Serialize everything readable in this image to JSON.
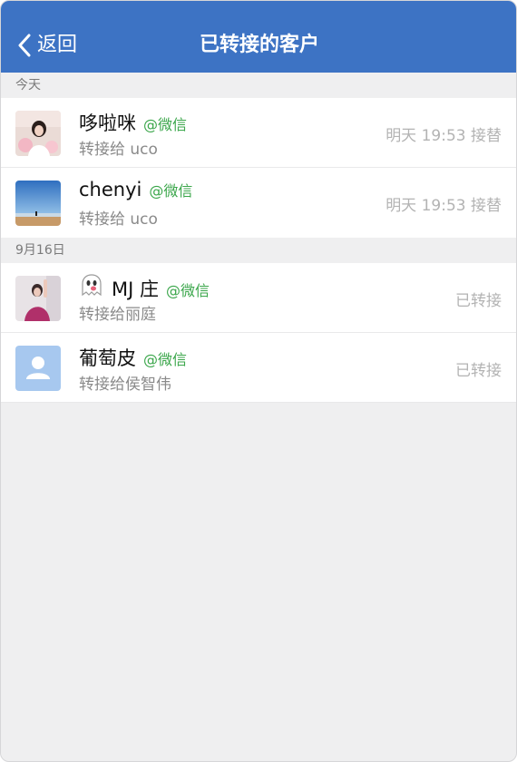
{
  "nav": {
    "back_label": "返回",
    "title": "已转接的客户"
  },
  "sections": [
    {
      "header": "今天",
      "rows": [
        {
          "name": "哆啦咪",
          "source": "@微信",
          "subtitle": "转接给 uco",
          "status": "明天 19:53 接替",
          "avatar": "photo-girl"
        },
        {
          "name": "chenyi",
          "source": "@微信",
          "subtitle": "转接给 uco",
          "status": "明天 19:53 接替",
          "avatar": "photo-beach"
        }
      ]
    },
    {
      "header": "9月16日",
      "rows": [
        {
          "name": "MJ 庄",
          "source": "@微信",
          "subtitle": "转接给丽庭",
          "status": "已转接",
          "avatar": "photo-girl-pink",
          "emoji": "ghost-emoji"
        },
        {
          "name": "葡萄皮",
          "source": "@微信",
          "subtitle": "转接给侯智伟",
          "status": "已转接",
          "avatar": "default-user-icon"
        }
      ]
    }
  ],
  "colors": {
    "nav_bg": "#3d73c4",
    "source_green": "#3aa64a",
    "status_gray": "#b3b3b3",
    "background": "#efeff0"
  }
}
